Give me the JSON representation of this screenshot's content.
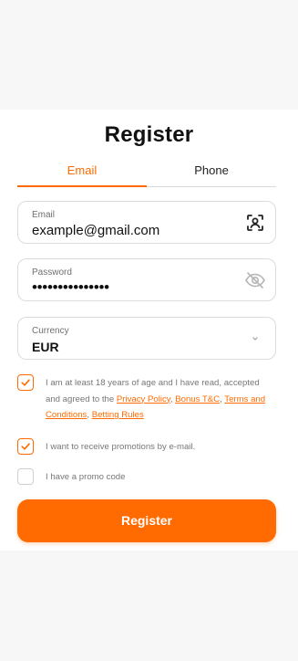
{
  "page": {
    "title": "Register"
  },
  "tabs": [
    {
      "label": "Email",
      "active": true
    },
    {
      "label": "Phone",
      "active": false
    }
  ],
  "form": {
    "email": {
      "label": "Email",
      "value": "example@gmail.com",
      "icon": "face-id-icon"
    },
    "password": {
      "label": "Password",
      "value": "•••••••••••••••",
      "icon": "eye-off-icon"
    },
    "currency": {
      "label": "Currency",
      "value": "EUR",
      "icon": "chevron-down-icon"
    }
  },
  "consents": {
    "terms": {
      "checked": true,
      "text_before": "I am at least 18 years of age and I have read, accepted and agreed to the ",
      "links": [
        "Privacy Policy",
        "Bonus T&C",
        "Terms and Conditions",
        "Betting Rules"
      ],
      "sep1": ", ",
      "sep2": ", ",
      "sep3": ", "
    },
    "promotions": {
      "checked": true,
      "text": "I want to receive promotions by e-mail."
    },
    "promo_code": {
      "checked": false,
      "text": "I have a promo code"
    }
  },
  "submit": {
    "label": "Register"
  },
  "colors": {
    "accent": "#ff6b00",
    "text": "#111111",
    "muted": "#777777",
    "border": "#dcdcdc"
  }
}
